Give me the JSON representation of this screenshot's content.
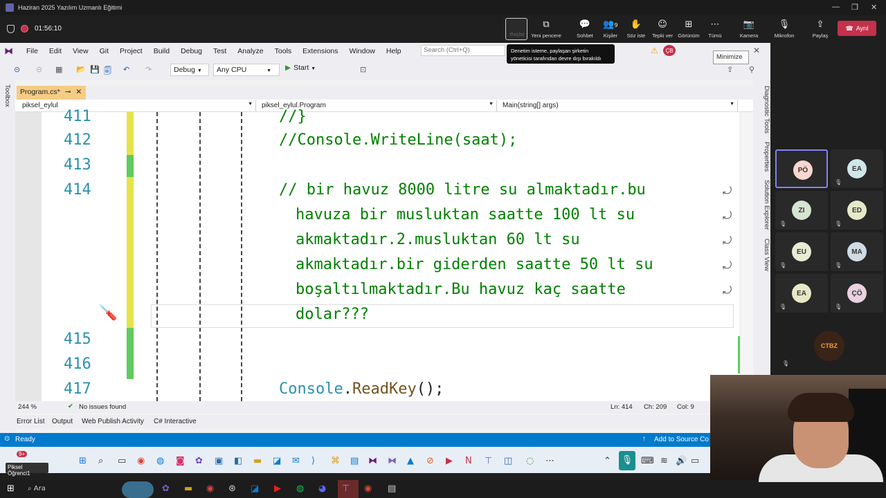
{
  "teams": {
    "window_title": "Haziran 2025 Yazılım Uzmanlı Eğitimi",
    "elapsed": "01:56:10",
    "buttons": [
      {
        "icon": "share-screen-icon",
        "label": "Paylaş"
      },
      {
        "icon": "new-window-icon",
        "label": "Yeni pencere"
      },
      {
        "icon": "chat-icon",
        "label": "Sohbet"
      },
      {
        "icon": "people-icon",
        "label": "Kişiler",
        "count": "9"
      },
      {
        "icon": "raise-hand-icon",
        "label": "Söz iste"
      },
      {
        "icon": "react-icon",
        "label": "Tepki ver"
      },
      {
        "icon": "view-icon",
        "label": "Görünüm"
      },
      {
        "icon": "more-icon",
        "label": "Tümü"
      },
      {
        "icon": "camera-icon",
        "label": "Kamera"
      },
      {
        "icon": "mic-icon",
        "label": "Mikrofon"
      },
      {
        "icon": "share-icon",
        "label": "Paylaş"
      }
    ],
    "leave_label": "Ayrıl",
    "tooltip": "Denetim isteme, paylaşan şirketin yöneticisi tarafından devre dışı bırakıldı",
    "participants": [
      {
        "initials": "PÖ",
        "color": "#f8d7cf",
        "muted": false,
        "active": true
      },
      {
        "initials": "EA",
        "color": "#cfe7e8",
        "muted": true
      },
      {
        "initials": "ZI",
        "color": "#d5e5d1",
        "muted": true
      },
      {
        "initials": "ED",
        "color": "#e6e9c8",
        "muted": true
      },
      {
        "initials": "EU",
        "color": "#e7ecd4",
        "muted": true
      },
      {
        "initials": "MA",
        "color": "#d0dbe4",
        "muted": true
      },
      {
        "initials": "EA",
        "color": "#e8e8c6",
        "muted": true
      },
      {
        "initials": "ÇÖ",
        "color": "#ead1df",
        "muted": true
      }
    ],
    "logo_text": "CTBZ"
  },
  "vs": {
    "menu": [
      "File",
      "Edit",
      "View",
      "Git",
      "Project",
      "Build",
      "Debug",
      "Test",
      "Analyze",
      "Tools",
      "Extensions",
      "Window",
      "Help"
    ],
    "search_placeholder": "Search (Ctrl+Q)",
    "user_badge": "ÇB",
    "minimize_tip": "Minimize",
    "config": "Debug",
    "platform": "Any CPU",
    "start_label": "Start",
    "toolbox_label": "Toolbox",
    "right_dock": [
      "Diagnostic Tools",
      "Properties",
      "Solution Explorer",
      "Class View"
    ],
    "tab": "Program.cs*",
    "nav": [
      "piksel_eylul",
      "piksel_eylul.Program",
      "Main(string[] args)"
    ],
    "code": {
      "l411_num": "411",
      "l411": "//}",
      "l412_num": "412",
      "l412": "//Console.WriteLine(saat);",
      "l413_num": "413",
      "l414_num": "414",
      "l414a": "// bir havuz 8000 litre su almaktadır.bu",
      "l414b": "havuza bir musluktan saatte 100 lt su",
      "l414c": "akmaktadır.2.musluktan 60 lt su",
      "l414d": "akmaktadır.bir giderden saatte 50 lt su",
      "l414e": "boşaltılmaktadır.Bu havuz kaç saatte",
      "l414f": "dolar???",
      "l415_num": "415",
      "l416_num": "416",
      "l417_num": "417",
      "l417_cls": "Console",
      "l417_dot": ".",
      "l417_m": "ReadKey",
      "l417_end": "();"
    },
    "zoom": "244 %",
    "issues": "No issues found",
    "ln": "Ln: 414",
    "ch": "Ch: 209",
    "col": "Col: 9",
    "bottom_tabs": [
      "Error List",
      "Output",
      "Web Publish Activity",
      "C# Interactive"
    ],
    "ready": "Ready",
    "add_source": "Add to Source Co"
  },
  "taskbar": {
    "badge": "9+",
    "tooltip": "Piksel Öğrenci1",
    "search": "Ara"
  }
}
